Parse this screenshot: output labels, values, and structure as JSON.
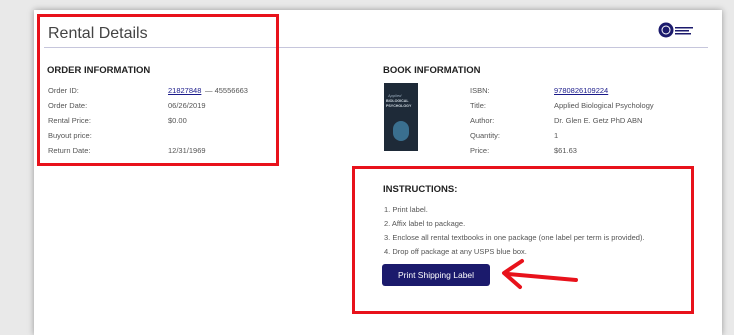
{
  "page": {
    "title": "Rental Details"
  },
  "order": {
    "heading": "ORDER INFORMATION",
    "order_id_label": "Order ID:",
    "order_id_link": "21827848",
    "order_id_suffix": "— 45556663",
    "order_date_label": "Order Date:",
    "order_date": "06/26/2019",
    "rental_price_label": "Rental Price:",
    "rental_price": "$0.00",
    "buyout_label": "Buyout price:",
    "return_date_label": "Return Date:",
    "return_date": "12/31/1969"
  },
  "book": {
    "heading": "BOOK INFORMATION",
    "isbn_label": "ISBN:",
    "isbn": "9780826109224",
    "title_label": "Title:",
    "title": "Applied Biological Psychology",
    "author_label": "Author:",
    "author": "Dr. Glen E. Getz PhD ABN",
    "quantity_label": "Quantity:",
    "quantity": "1",
    "price_label": "Price:",
    "price": "$61.63",
    "cover_text_top": "Applied",
    "cover_text_main": "BIOLOGICAL PSYCHOLOGY"
  },
  "instructions": {
    "heading": "INSTRUCTIONS:",
    "steps": [
      "1. Print label.",
      "2. Affix label to package.",
      "3. Enclose all rental textbooks in one package (one label per term is provided).",
      "4. Drop off package at any USPS blue box."
    ],
    "button_label": "Print Shipping Label"
  },
  "colors": {
    "highlight": "#e8121b",
    "button": "#1b1a6c",
    "link": "#1a1a8a"
  }
}
